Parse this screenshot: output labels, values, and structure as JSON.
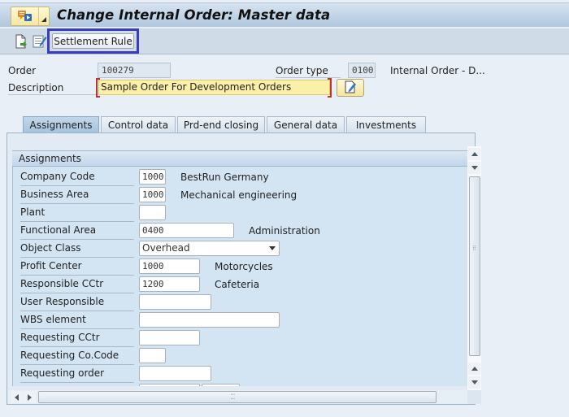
{
  "window": {
    "title": "Change Internal Order: Master data"
  },
  "titlebar": {
    "menu_icon": "sap-menu-icon",
    "menu_dropdown_icon": "chevron-down-icon"
  },
  "toolbar": {
    "icons": [
      "new-document-icon",
      "edit-list-icon"
    ],
    "settlement_rule_label": "Settlement Rule"
  },
  "header": {
    "order_label": "Order",
    "order_value": "100279",
    "order_type_label": "Order type",
    "order_type_value": "0100",
    "order_type_desc": "Internal Order - D...",
    "description_label": "Description",
    "description_value": "Sample Order For Development Orders",
    "long_text_icon": "edit-text-icon"
  },
  "tabs": [
    {
      "label": "Assignments",
      "active": true
    },
    {
      "label": "Control data",
      "active": false
    },
    {
      "label": "Prd-end closing",
      "active": false
    },
    {
      "label": "General data",
      "active": false
    },
    {
      "label": "Investments",
      "active": false
    }
  ],
  "assignments": {
    "group_title": "Assignments",
    "fields": [
      {
        "label": "Company Code",
        "value": "1000",
        "desc": "BestRun Germany"
      },
      {
        "label": "Business Area",
        "value": "1000",
        "desc": "Mechanical engineering"
      },
      {
        "label": "Plant",
        "value": "",
        "desc": ""
      },
      {
        "label": "Functional Area",
        "value": "0400",
        "desc": "Administration"
      },
      {
        "label": "Object Class",
        "value": "Overhead",
        "desc": ""
      },
      {
        "label": "Profit Center",
        "value": "1000",
        "desc": "Motorcycles"
      },
      {
        "label": "Responsible CCtr",
        "value": "1200",
        "desc": "Cafeteria"
      },
      {
        "label": "User Responsible",
        "value": "",
        "desc": ""
      },
      {
        "label": "WBS element",
        "value": "",
        "desc": ""
      },
      {
        "label": "Requesting CCtr",
        "value": "",
        "desc": ""
      },
      {
        "label": "Requesting Co.Code",
        "value": "",
        "desc": ""
      },
      {
        "label": "Requesting order",
        "value": "",
        "desc": ""
      }
    ]
  },
  "colors": {
    "highlight_frame": "#3a3cc0",
    "required_marker": "#c43030",
    "description_bg": "#fbf0a8"
  }
}
